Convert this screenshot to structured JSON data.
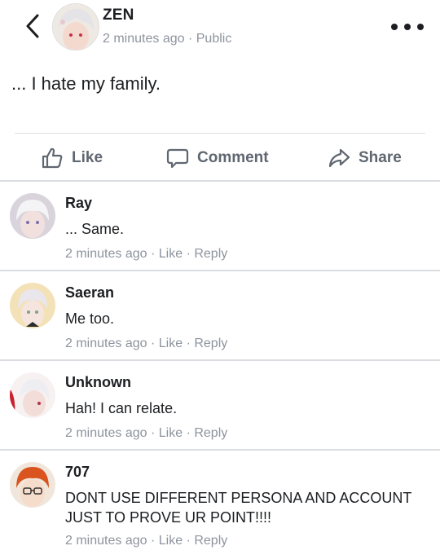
{
  "post": {
    "author": "ZEN",
    "time": "2 minutes ago",
    "separator": "·",
    "visibility": "Public",
    "text": "... I hate my family."
  },
  "actions": {
    "like": "Like",
    "comment": "Comment",
    "share": "Share"
  },
  "comments": [
    {
      "name": "Ray",
      "text": "... Same.",
      "time": "2 minutes ago",
      "like": "Like",
      "reply": "Reply"
    },
    {
      "name": "Saeran",
      "text": "Me too.",
      "time": "2 minutes ago",
      "like": "Like",
      "reply": "Reply"
    },
    {
      "name": "Unknown",
      "text": "Hah! I can relate.",
      "time": "2 minutes ago",
      "like": "Like",
      "reply": "Reply"
    },
    {
      "name": "707",
      "text": "DONT USE DIFFERENT PERSONA AND ACCOUNT JUST TO PROVE UR POINT!!!!",
      "time": "2 minutes ago",
      "like": "Like",
      "reply": "Reply"
    }
  ],
  "icons": {
    "back": "chevron-left-icon",
    "more": "more-dots-icon",
    "like": "thumbs-up-icon",
    "comment": "speech-bubble-icon",
    "share": "share-arrow-icon"
  },
  "colors": {
    "text": "#1c1e21",
    "meta": "#8d949e",
    "action": "#606770",
    "divider": "#dadde1"
  }
}
